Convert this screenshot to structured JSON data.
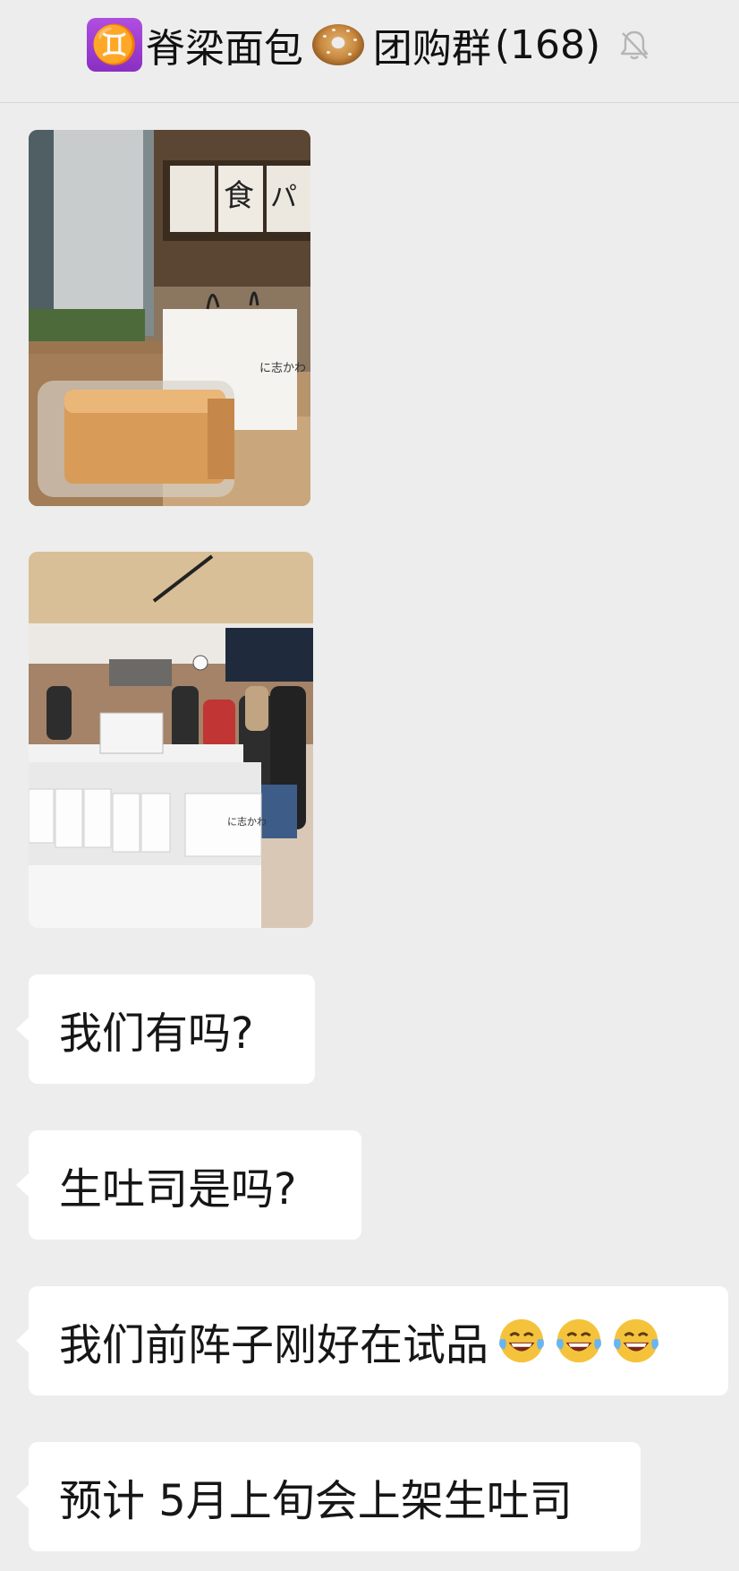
{
  "header": {
    "title": "脊梁面包",
    "title_suffix": "团购群",
    "member_count": "(168)",
    "icons": [
      "gemini-icon",
      "bagel-icon",
      "mute-bell-icon"
    ]
  },
  "messages": [
    {
      "type": "image",
      "icon": "photo-shop-bread-bag"
    },
    {
      "type": "image",
      "icon": "photo-shop-interior-queue"
    },
    {
      "type": "text",
      "text": "我们有吗?"
    },
    {
      "type": "text",
      "text": "生吐司是吗?"
    },
    {
      "type": "text",
      "text": "我们前阵子刚好在试品",
      "emoji": [
        "laughing-tears-icon",
        "laughing-tears-icon",
        "laughing-tears-icon"
      ]
    },
    {
      "type": "text",
      "text": "预计 5月上旬会上架生吐司"
    }
  ],
  "colors": {
    "background": "#ededed",
    "bubble": "#ffffff",
    "text": "#111111"
  }
}
